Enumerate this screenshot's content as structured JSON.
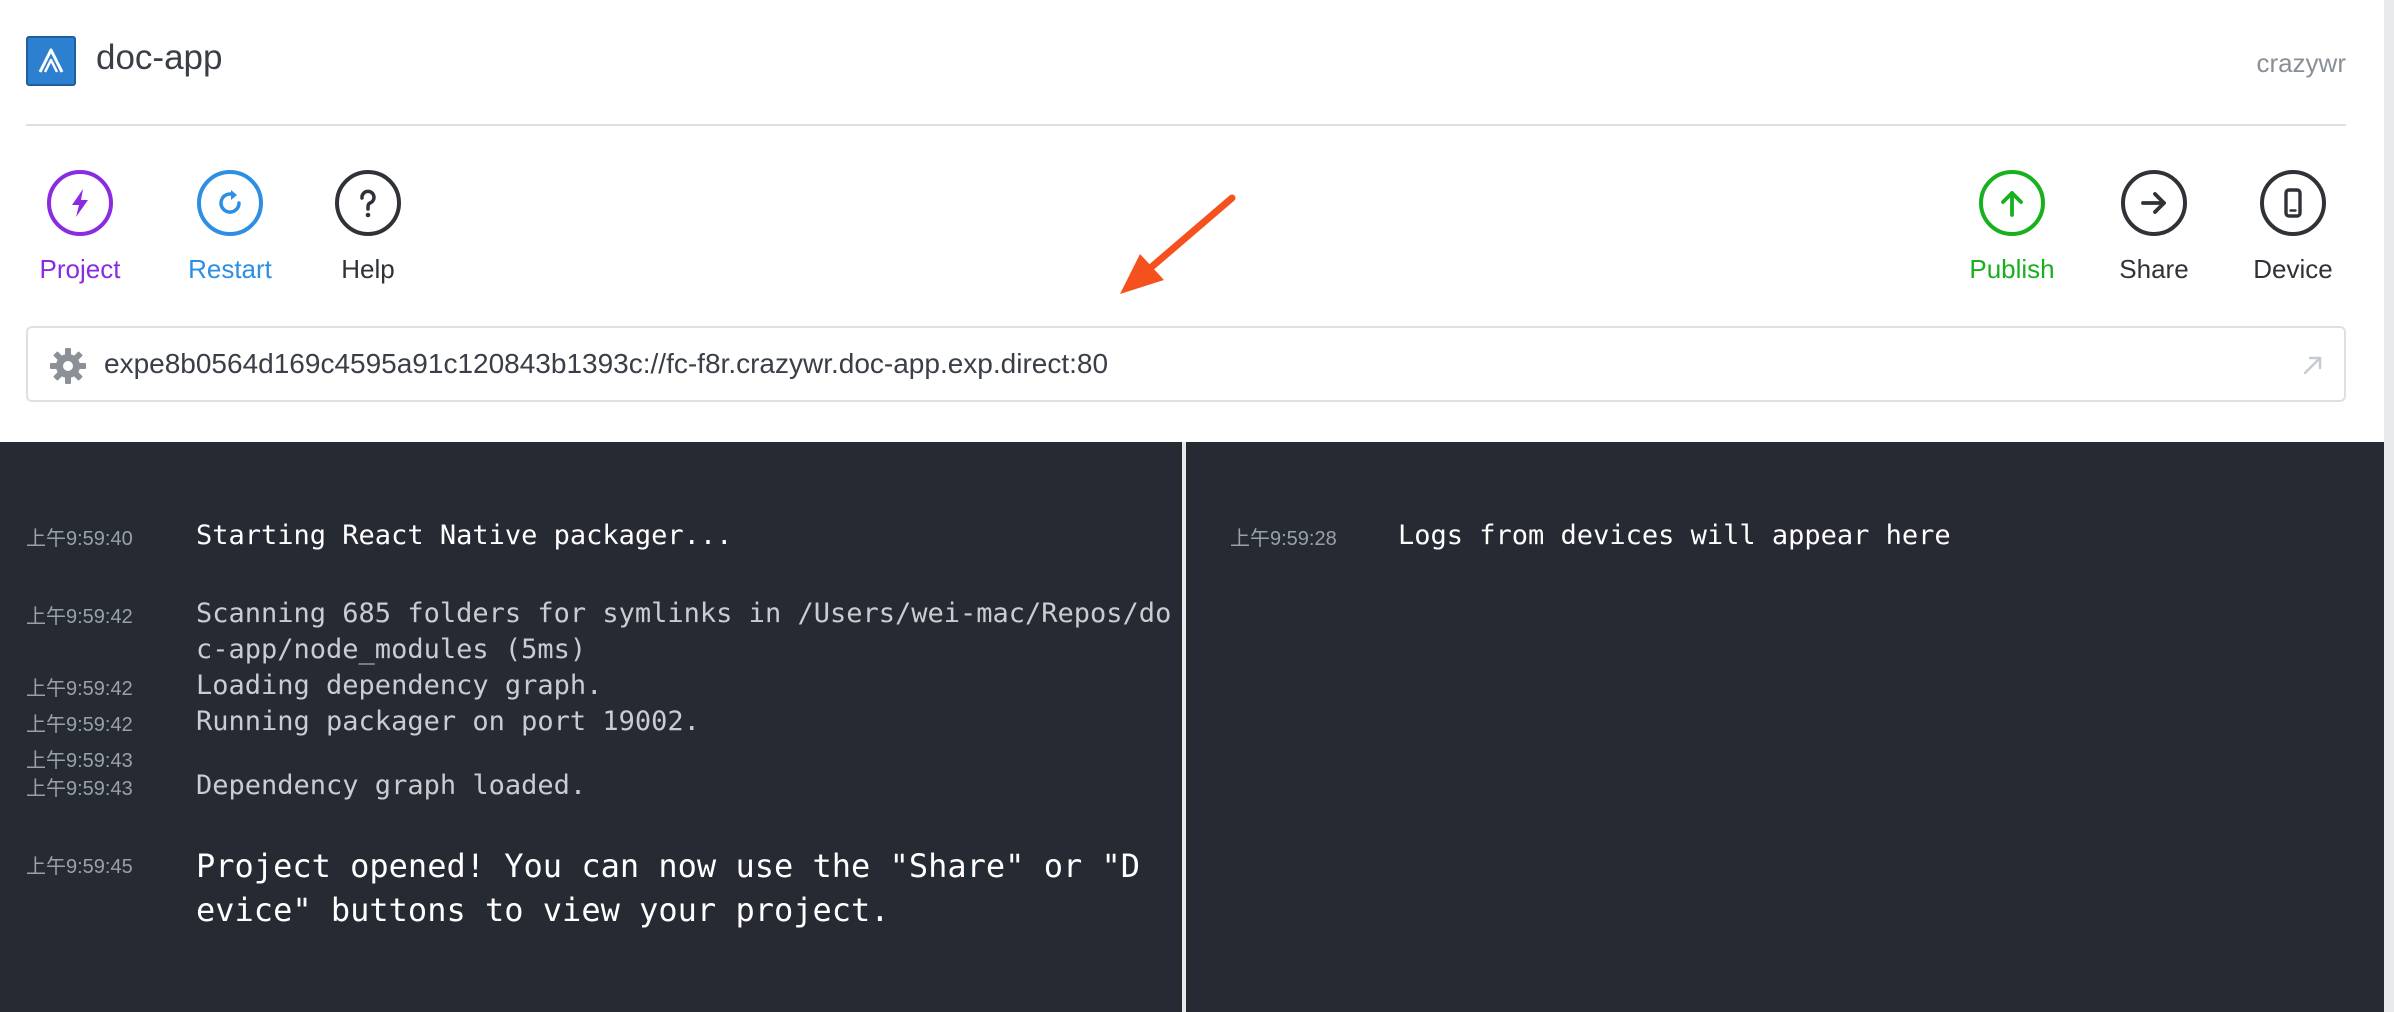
{
  "header": {
    "app_title": "doc-app",
    "username": "crazywr"
  },
  "toolbar": {
    "left": [
      {
        "label": "Project",
        "icon": "lightning-icon",
        "color": "#8a2be2"
      },
      {
        "label": "Restart",
        "icon": "restart-icon",
        "color": "#2d8fe3"
      },
      {
        "label": "Help",
        "icon": "question-icon",
        "color": "#2f3338"
      }
    ],
    "right": [
      {
        "label": "Publish",
        "icon": "upload-arrow-icon",
        "color": "#18b01e"
      },
      {
        "label": "Share",
        "icon": "arrow-right-icon",
        "color": "#2f3338"
      },
      {
        "label": "Device",
        "icon": "phone-icon",
        "color": "#2f3338"
      }
    ]
  },
  "urlbar": {
    "value": "expe8b0564d169c4595a91c120843b1393c://fc-f8r.crazywr.doc-app.exp.direct:80",
    "settings_icon": "gear-icon",
    "open_icon": "external-link-icon"
  },
  "packager_logs": [
    {
      "time": "上午9:59:40",
      "message": "Starting React Native packager...",
      "style": "bright"
    },
    {
      "time": "上午9:59:42",
      "message": "Scanning 685 folders for symlinks in /Users/wei-mac/Repos/do\nc-app/node_modules (5ms)",
      "style": "normal"
    },
    {
      "time": "上午9:59:42",
      "message": "Loading dependency graph.",
      "style": "normal"
    },
    {
      "time": "上午9:59:42",
      "message": "Running packager on port 19002.",
      "style": "normal"
    },
    {
      "time": "上午9:59:43",
      "message": "",
      "style": "normal"
    },
    {
      "time": "上午9:59:43",
      "message": "Dependency graph loaded.",
      "style": "normal"
    },
    {
      "time": "上午9:59:45",
      "message": "Project opened! You can now use the \"Share\" or \"D\nevice\" buttons to view your project.",
      "style": "big"
    }
  ],
  "device_logs": [
    {
      "time": "上午9:59:28",
      "message": "Logs from devices will appear here",
      "style": "bright"
    }
  ],
  "colors": {
    "log_background": "#262a33",
    "annotation_arrow": "#f4511e"
  }
}
